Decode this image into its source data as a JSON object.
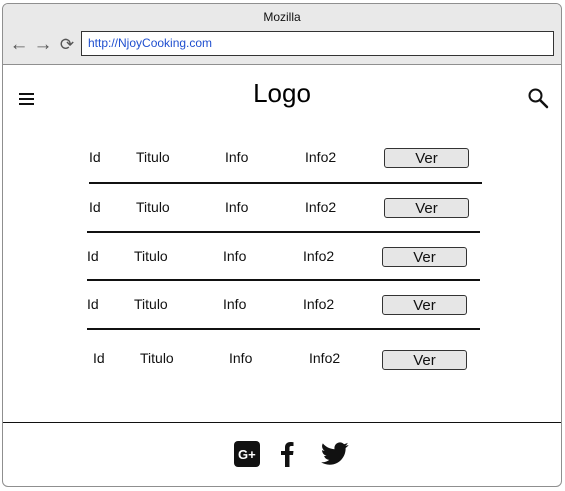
{
  "browser": {
    "title": "Mozilla",
    "url": "http://NjoyCooking.com"
  },
  "header": {
    "logo": "Logo"
  },
  "rows": [
    {
      "id": "Id",
      "titulo": "Titulo",
      "info": "Info",
      "info2": "Info2",
      "button": "Ver"
    },
    {
      "id": "Id",
      "titulo": "Titulo",
      "info": "Info",
      "info2": "Info2",
      "button": "Ver"
    },
    {
      "id": "Id",
      "titulo": "Titulo",
      "info": "Info",
      "info2": "Info2",
      "button": "Ver"
    },
    {
      "id": "Id",
      "titulo": "Titulo",
      "info": "Info",
      "info2": "Info2",
      "button": "Ver"
    },
    {
      "id": "Id",
      "titulo": "Titulo",
      "info": "Info",
      "info2": "Info2",
      "button": "Ver"
    }
  ],
  "footer": {
    "social_icons": [
      "google-plus-icon",
      "facebook-icon",
      "twitter-icon"
    ]
  }
}
